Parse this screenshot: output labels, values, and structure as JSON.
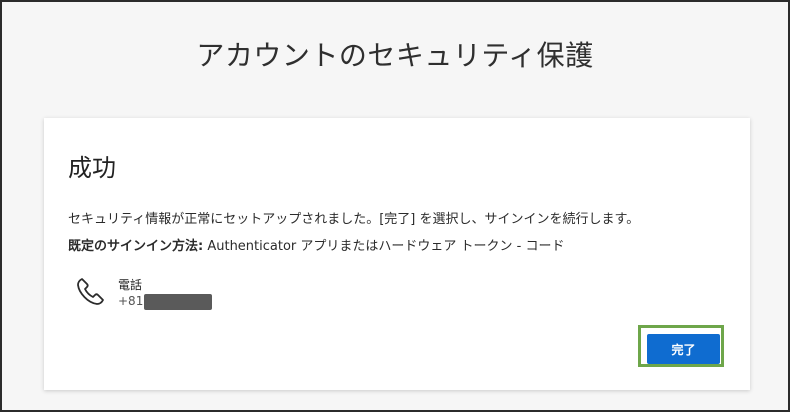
{
  "page": {
    "title": "アカウントのセキュリティ保護"
  },
  "card": {
    "title": "成功",
    "message": "セキュリティ情報が正常にセットアップされました。[完了] を選択し、サインインを続行します。",
    "default_label": "既定のサインイン方法:",
    "default_value": " Authenticator アプリまたはハードウェア トークン - コード",
    "method": {
      "icon": "phone-icon",
      "name": "電話",
      "value": "+81"
    },
    "done_label": "完了"
  },
  "colors": {
    "primary": "#0f6cd0",
    "highlight": "#6ea64a"
  }
}
